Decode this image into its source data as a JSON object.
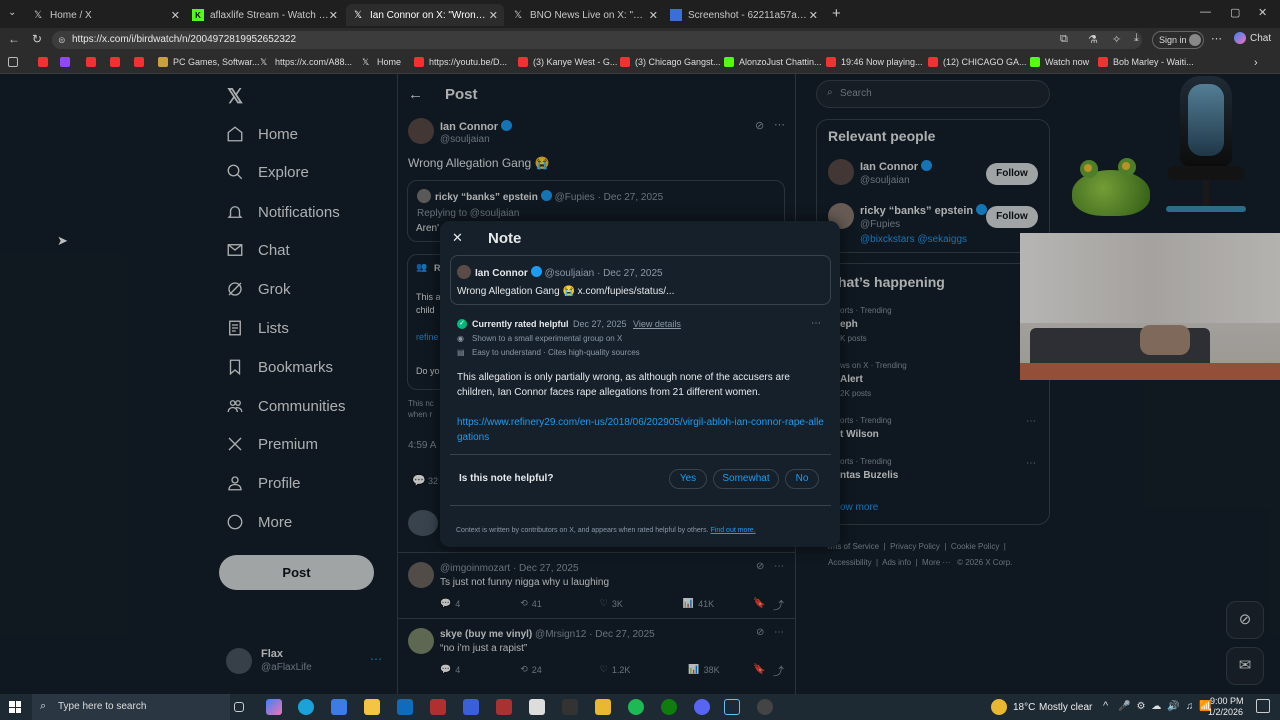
{
  "browser": {
    "tabs": [
      {
        "title": "Home / X"
      },
      {
        "title": "aflaxlife Stream - Watch Live on Kick"
      },
      {
        "title": "Ian Connor on X: \"Wrong Allegation Gang\""
      },
      {
        "title": "BNO News Live on X: \"New video"
      },
      {
        "title": "Screenshot - 62211a57a4f38069e"
      }
    ],
    "url": "https://x.com/i/birdwatch/n/2004972819952652322",
    "sign_in": "Sign in",
    "chat": "Chat",
    "bookmarks": [
      "PC Games, Softwar...",
      "https://x.com/A88...",
      "Home",
      "https://youtu.be/D...",
      "(3) Kanye West - G...",
      "(3) Chicago Gangst...",
      "AlonzoJust Chattin...",
      "19:46 Now playing...",
      "(12) CHICAGO GA...",
      "Watch now",
      "Bob Marley - Waiti..."
    ]
  },
  "sidebar": {
    "items": [
      "Home",
      "Explore",
      "Notifications",
      "Chat",
      "Grok",
      "Lists",
      "Bookmarks",
      "Communities",
      "Premium",
      "Profile",
      "More"
    ],
    "post_button": "Post",
    "account_name": "Flax",
    "account_handle": "@aFlaxLife"
  },
  "main": {
    "header": "Post",
    "author_name": "Ian Connor",
    "author_handle": "@souljaian",
    "text": "Wrong Allegation Gang 😭",
    "quote": {
      "name": "ricky “banks” epstein",
      "handle": "@Fupies",
      "date": "· Dec 27, 2025",
      "replying": "Replying to @souljaian",
      "snippet": "Aren'"
    },
    "partial": {
      "r": "R",
      "this": "This a",
      "child": "child",
      "refine": "refine",
      "do": "Do yo",
      "time": "4:59 A",
      "count": "32",
      "this2": "This nc",
      "when": "when r"
    },
    "replies": [
      {
        "name": "",
        "handle": "@imgoinmozart",
        "date": "· Dec 27, 2025",
        "text": "Ts just not funny nigga why u laughing",
        "r": "4",
        "rt": "41",
        "likes": "3K",
        "views": "41K"
      },
      {
        "name": "skye (buy me vinyl)",
        "handle": "@Mrsign12",
        "date": "· Dec 27, 2025",
        "text": "“no i’m just a rapist”",
        "r": "4",
        "rt": "24",
        "likes": "1.2K",
        "views": "38K"
      }
    ]
  },
  "right": {
    "search_placeholder": "Search",
    "relevant_title": "Relevant people",
    "people": [
      {
        "name": "Ian Connor",
        "handle": "@souljaian",
        "follow": "Follow"
      },
      {
        "name": "ricky “banks” epstein",
        "handle": "@Fupies",
        "follow": "Follow",
        "bio": "@bixckstars @sekaiggs"
      }
    ],
    "happening_title": "hat’s happening",
    "trends": [
      {
        "meta": "orts · Trending",
        "name": "eph",
        "count": "K posts"
      },
      {
        "meta": "ws on X · Trending",
        "name": "Alert",
        "count": "2K posts"
      },
      {
        "meta": "orts · Trending",
        "name": "t Wilson",
        "count": ""
      },
      {
        "meta": "orts · Trending",
        "name": "ntas Buzelis",
        "count": ""
      }
    ],
    "show_more": "ow more",
    "footer": [
      "rms of Service",
      "Privacy Policy",
      "Cookie Policy",
      "Accessibility",
      "Ads info",
      "More ···",
      "© 2026 X Corp."
    ]
  },
  "note": {
    "title": "Note",
    "author_name": "Ian Connor",
    "author_handle": "@souljaian",
    "date": "· Dec 27, 2025",
    "tweet_text": "Wrong Allegation Gang 😭 x.com/fupies/status/...",
    "status": "Currently rated helpful",
    "status_date": "Dec 27, 2025",
    "view_details": "View details",
    "shown": "Shown to a small experimental group on X",
    "easy": "Easy to understand · Cites high-quality sources",
    "body": "This allegation is only partially wrong, as although none of the accusers are children, Ian Connor faces rape allegations from 21 different women.",
    "link": "https://www.refinery29.com/en-us/2018/06/202905/virgil-abloh-ian-connor-rape-allegations",
    "question": "Is this note helpful?",
    "yes": "Yes",
    "somewhat": "Somewhat",
    "no": "No",
    "footer": "Context is written by contributors on X, and appears when rated helpful by others.",
    "find_out": "Find out more."
  },
  "taskbar": {
    "search": "Type here to search",
    "temp": "18°C",
    "weather": "Mostly clear",
    "time": "9:00 PM",
    "date": "1/2/2026"
  }
}
